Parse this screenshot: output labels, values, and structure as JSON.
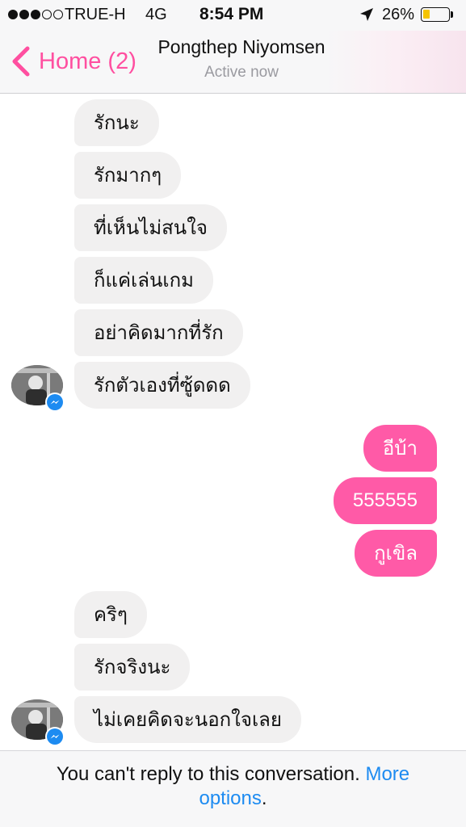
{
  "status_bar": {
    "carrier": "TRUE-H",
    "network": "4G",
    "time": "8:54 PM",
    "battery_percent": "26%",
    "battery_level": 0.26,
    "signal_bars_filled": 3,
    "signal_bars_total": 5
  },
  "nav": {
    "back_label": "Home (2)",
    "title": "Pongthep Niyomsen",
    "subtitle": "Active now",
    "accent_color": "#ff4fa0"
  },
  "messages": [
    {
      "text": "รักนะ",
      "direction": "incoming"
    },
    {
      "text": "รักมากๆ",
      "direction": "incoming"
    },
    {
      "text": "ที่เห็นไม่สนใจ",
      "direction": "incoming"
    },
    {
      "text": "ก็แค่เล่นเกม",
      "direction": "incoming"
    },
    {
      "text": "อย่าคิดมากที่รัก",
      "direction": "incoming"
    },
    {
      "text": "รักตัวเองที่ซู้ดดด",
      "direction": "incoming"
    },
    {
      "text": "อีบ้า",
      "direction": "outgoing"
    },
    {
      "text": "555555",
      "direction": "outgoing"
    },
    {
      "text": "กูเขิล",
      "direction": "outgoing"
    },
    {
      "text": "คริๆ",
      "direction": "incoming"
    },
    {
      "text": "รักจริงนะ",
      "direction": "incoming"
    },
    {
      "text": "ไม่เคยคิดจะนอกใจเลย",
      "direction": "incoming"
    }
  ],
  "colors": {
    "outgoing_bubble": "#ff5aa7",
    "incoming_bubble": "#f1f0f0",
    "link": "#1d8bf1",
    "messenger_badge": "#1d8bf1",
    "battery_fill": "#f5c400"
  },
  "footer": {
    "text": "You can't reply to this conversation.",
    "link_text": "More options",
    "suffix": "."
  },
  "icons": {
    "back": "chevron-left-icon",
    "location": "location-arrow-icon",
    "battery": "battery-icon",
    "badge": "messenger-icon"
  }
}
